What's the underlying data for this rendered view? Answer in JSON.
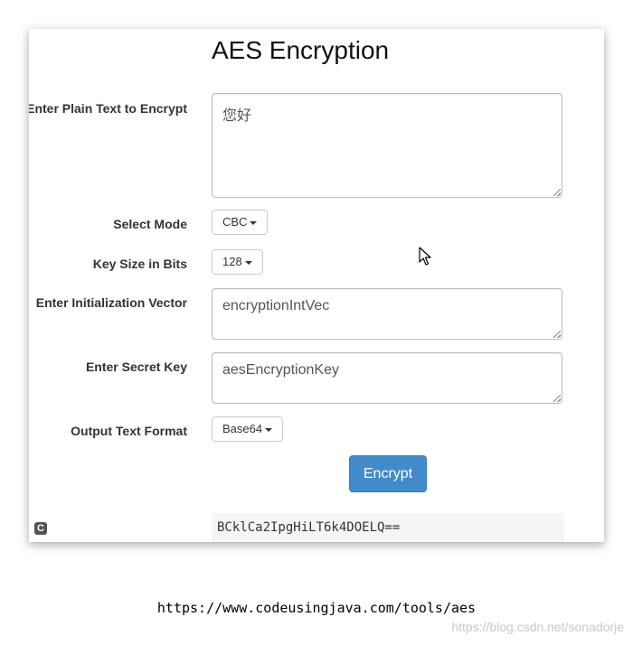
{
  "page": {
    "title": "AES Encryption",
    "footer_url": "https://www.codeusingjava.com/tools/aes",
    "watermark": "https://blog.csdn.net/sonadorje"
  },
  "form": {
    "plain_text": {
      "label": "Enter Plain Text to Encrypt",
      "value": "您好"
    },
    "mode": {
      "label": "Select Mode",
      "selected": "CBC"
    },
    "key_size": {
      "label": "Key Size in Bits",
      "selected": "128"
    },
    "iv": {
      "label": "Enter Initialization Vector",
      "value": "encryptionIntVec"
    },
    "secret_key": {
      "label": "Enter Secret Key",
      "value": "aesEncryptionKey"
    },
    "output_format": {
      "label": "Output Text Format",
      "selected": "Base64"
    },
    "encrypt_label": "Encrypt"
  },
  "result": {
    "value": "BCklCa2IpgHiLT6k4DOELQ=="
  },
  "icons": {
    "corner": "c-logo-icon",
    "cursor": "mouse-pointer-icon"
  },
  "colors": {
    "primary": "#428bca",
    "output_bg": "#f5f5f5"
  }
}
